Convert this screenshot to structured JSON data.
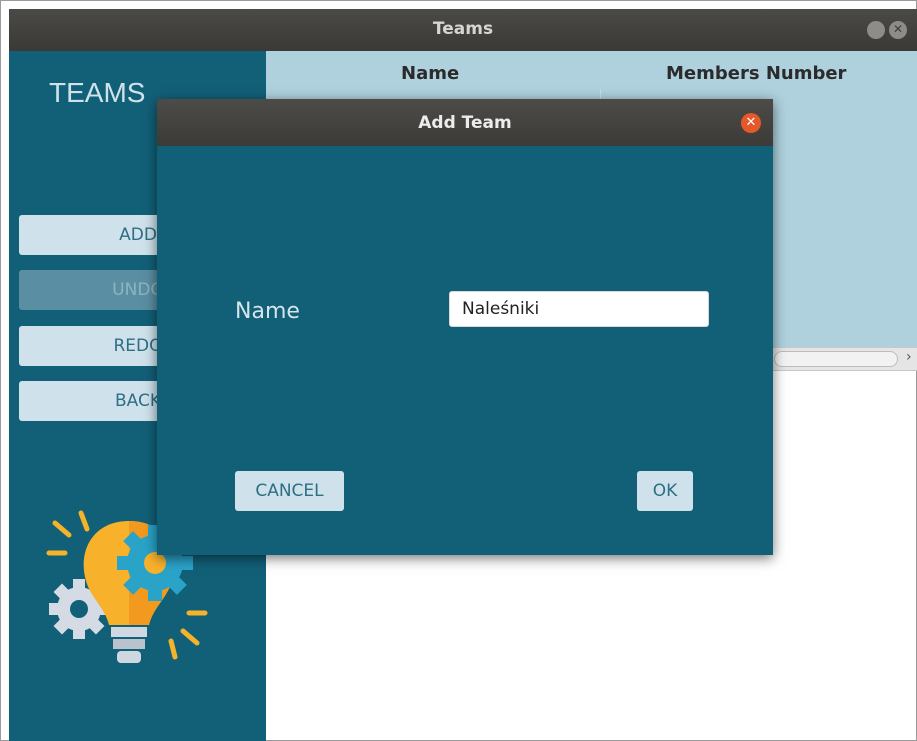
{
  "window": {
    "title": "Teams"
  },
  "sidebar": {
    "heading": "TEAMS",
    "buttons": {
      "add": "ADD",
      "undo": "UNDO",
      "redo": "REDO",
      "back": "BACK"
    }
  },
  "table": {
    "columns": [
      "Name",
      "Members Number"
    ]
  },
  "dialog": {
    "title": "Add Team",
    "field_label": "Name",
    "name_value": "Naleśniki",
    "cancel_label": "CANCEL",
    "ok_label": "OK"
  },
  "colors": {
    "sidebar": "#126078",
    "table_header": "#aed1dd",
    "button_bg": "#cfe2ec",
    "button_text": "#2e6f85",
    "dialog_close": "#e4582a"
  }
}
